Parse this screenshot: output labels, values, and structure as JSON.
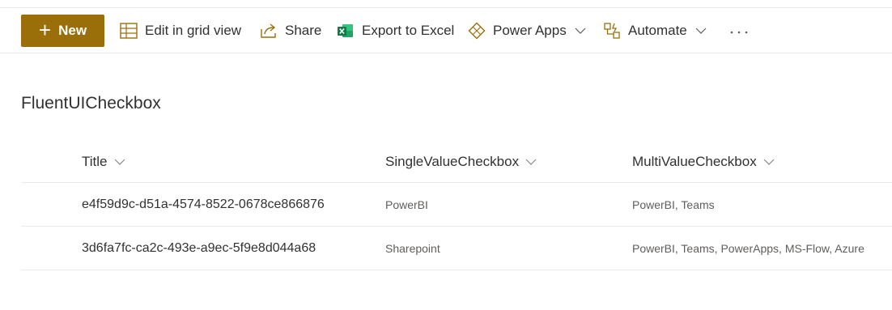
{
  "command_bar": {
    "new_label": "New",
    "edit_grid_label": "Edit in grid view",
    "share_label": "Share",
    "export_label": "Export to Excel",
    "power_apps_label": "Power Apps",
    "automate_label": "Automate",
    "more_label": "···"
  },
  "colors": {
    "accent": "#9a6f0a",
    "excel_green": "#107c41",
    "text": "#323130",
    "subtle_text": "#605e5c",
    "divider": "#edebe9"
  },
  "list": {
    "title": "FluentUICheckbox",
    "columns": [
      "Title",
      "SingleValueCheckbox",
      "MultiValueCheckbox"
    ],
    "rows": [
      {
        "title": "e4f59d9c-d51a-4574-8522-0678ce866876",
        "single": "PowerBI",
        "multi": "PowerBI, Teams"
      },
      {
        "title": "3d6fa7fc-ca2c-493e-a9ec-5f9e8d044a68",
        "single": "Sharepoint",
        "multi": "PowerBI, Teams, PowerApps, MS-Flow, Azure"
      }
    ]
  }
}
